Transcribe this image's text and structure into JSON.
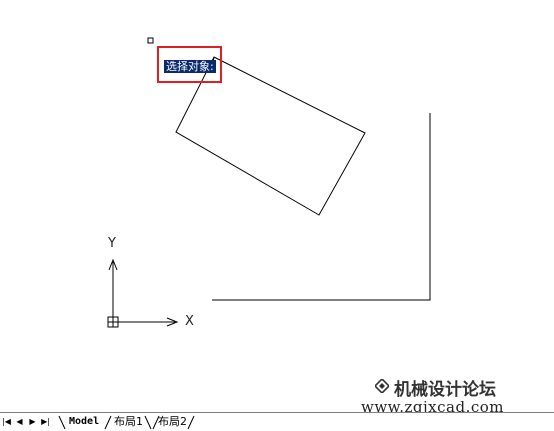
{
  "prompt": {
    "text": "选择对象:"
  },
  "ucs": {
    "x_label": "X",
    "y_label": "Y"
  },
  "tabs": {
    "nav_first": "|◀",
    "nav_prev": "◀",
    "nav_next": "▶",
    "nav_last": "▶|",
    "items": [
      {
        "label": "Model",
        "active": true
      },
      {
        "label": "布局1",
        "active": false
      },
      {
        "label": "布局2",
        "active": false
      }
    ]
  },
  "watermark": {
    "title": "机械设计论坛",
    "url": "www.zgjxcad.com"
  },
  "colors": {
    "background": "#ffffff",
    "lines": "#000000",
    "highlight_border": "#e02020",
    "prompt_bg": "#0a2a6e"
  }
}
